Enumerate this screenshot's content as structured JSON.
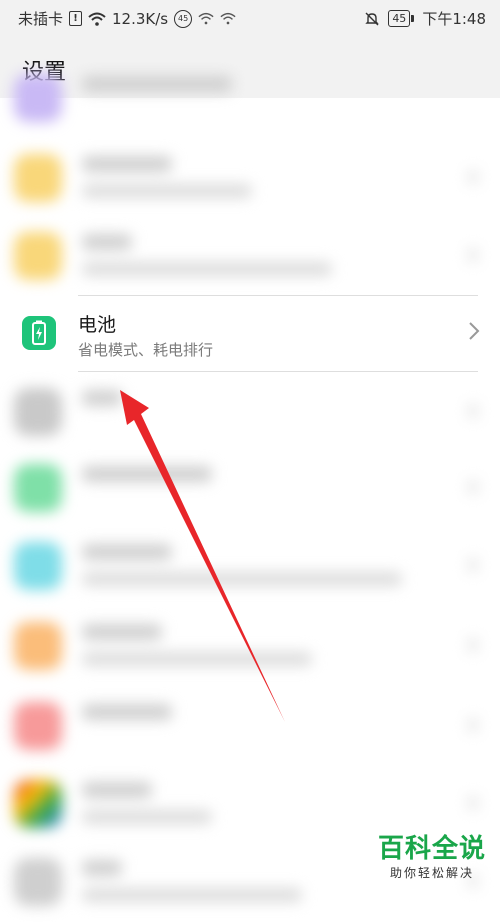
{
  "status_bar": {
    "carrier": "未插卡",
    "speed": "12.3K/s",
    "network_badge": "45",
    "battery_level": "45",
    "time": "下午1:48"
  },
  "header": {
    "title": "设置"
  },
  "settings_items": {
    "battery": {
      "title": "电池",
      "subtitle": "省电模式、耗电排行"
    }
  },
  "icons": [
    "wifi-icon",
    "notification-muted-icon",
    "battery-icon",
    "chevron-right-icon"
  ],
  "colors": {
    "battery_icon_bg": "#1ec47a",
    "arrow": "#e8262a",
    "watermark": "#1aa64a"
  },
  "watermark": {
    "logo": "百科全说",
    "sub": "助你轻松解决"
  }
}
